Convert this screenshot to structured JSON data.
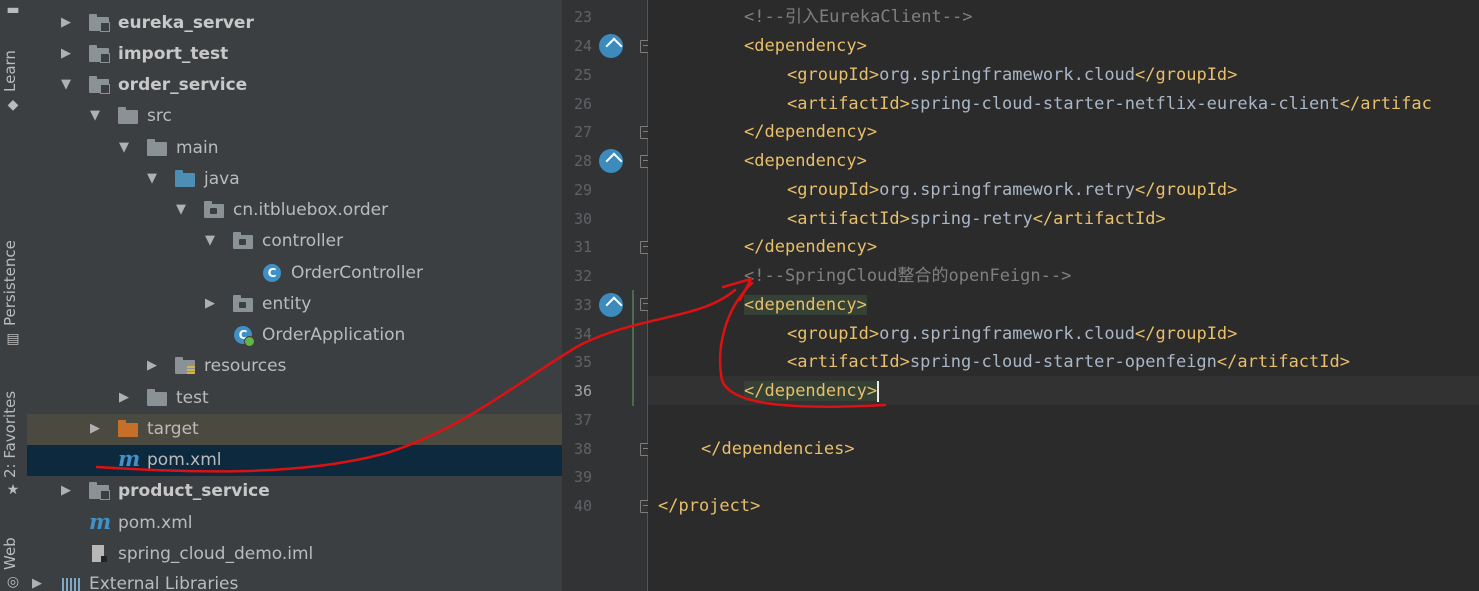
{
  "side_tabs": {
    "learn": "Learn",
    "persistence": "Persistence",
    "favorites": "2: Favorites",
    "web": "Web"
  },
  "project_tree": [
    {
      "label": "eureka_server",
      "bold": true,
      "expanded": false,
      "icon": "module-folder-icon"
    },
    {
      "label": "import_test",
      "bold": true,
      "expanded": false,
      "icon": "module-folder-icon"
    },
    {
      "label": "order_service",
      "bold": true,
      "expanded": true,
      "icon": "module-folder-icon"
    },
    {
      "label": "src",
      "bold": false,
      "expanded": true,
      "icon": "folder-icon"
    },
    {
      "label": "main",
      "bold": false,
      "expanded": true,
      "icon": "folder-icon"
    },
    {
      "label": "java",
      "bold": false,
      "expanded": true,
      "icon": "source-folder-icon"
    },
    {
      "label": "cn.itbluebox.order",
      "bold": false,
      "expanded": true,
      "icon": "package-icon"
    },
    {
      "label": "controller",
      "bold": false,
      "expanded": true,
      "icon": "package-icon"
    },
    {
      "label": "OrderController",
      "bold": false,
      "icon": "java-class-icon"
    },
    {
      "label": "entity",
      "bold": false,
      "expanded": false,
      "icon": "package-icon"
    },
    {
      "label": "OrderApplication",
      "bold": false,
      "icon": "spring-boot-app-icon"
    },
    {
      "label": "resources",
      "bold": false,
      "expanded": false,
      "icon": "resources-folder-icon"
    },
    {
      "label": "test",
      "bold": false,
      "expanded": false,
      "icon": "folder-icon"
    },
    {
      "label": "target",
      "bold": false,
      "expanded": false,
      "icon": "excluded-folder-icon"
    },
    {
      "label": "pom.xml",
      "bold": false,
      "icon": "maven-icon"
    },
    {
      "label": "product_service",
      "bold": true,
      "expanded": false,
      "icon": "module-folder-icon"
    },
    {
      "label": "pom.xml",
      "bold": false,
      "icon": "maven-icon"
    },
    {
      "label": "spring_cloud_demo.iml",
      "bold": false,
      "icon": "iml-file-icon"
    },
    {
      "label": "External Libraries",
      "bold": false,
      "expanded": false,
      "icon": "libraries-icon"
    }
  ],
  "editor": {
    "line_numbers": [
      "23",
      "24",
      "25",
      "26",
      "27",
      "28",
      "29",
      "30",
      "31",
      "32",
      "33",
      "34",
      "35",
      "36",
      "37",
      "38",
      "39",
      "40"
    ],
    "current_line": "36",
    "lines": {
      "l23_comment": "<!--引入EurekaClient-->",
      "dependency": "dependency",
      "groupId": "groupId",
      "artifactId": "artifactId",
      "artifac_cut": "artifac",
      "cloud_group": "org.springframework.cloud",
      "eureka_artifact": "spring-cloud-starter-netflix-eureka-client",
      "retry_group": "org.springframework.retry",
      "retry_artifact": "spring-retry",
      "l32_comment": "<!--SpringCloud整合的openFeign-->",
      "openfeign_artifact": "spring-cloud-starter-openfeign",
      "dependencies": "dependencies",
      "project": "project"
    }
  },
  "colors": {
    "annotation_red": "#dd1111",
    "tag_yellow": "#e8bf6a",
    "selection_blue": "#0d293e"
  }
}
